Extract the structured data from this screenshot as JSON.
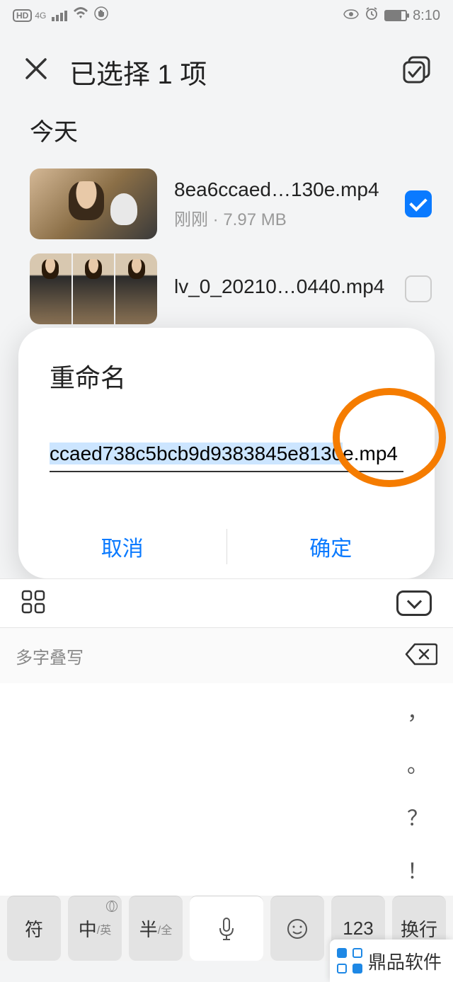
{
  "status_bar": {
    "hd": "HD",
    "net_gen": "4G",
    "time": "8:10"
  },
  "header": {
    "title": "已选择 1 项"
  },
  "section": {
    "today": "今天"
  },
  "files": [
    {
      "name": "8ea6ccaed…130e.mp4",
      "meta": "刚刚 · 7.97 MB",
      "checked": true
    },
    {
      "name": "lv_0_20210…0440.mp4",
      "meta": "",
      "checked": false
    }
  ],
  "dialog": {
    "title": "重命名",
    "filename_sel": "ccaed738c5bcb9d9383845e8130",
    "filename_ext": "e.mp4",
    "cancel": "取消",
    "confirm": "确定"
  },
  "keyboard": {
    "suggest": "多字叠写",
    "symbols": [
      "，",
      "。",
      "？",
      "！"
    ],
    "keys": {
      "sym": "符",
      "cn": "中",
      "cn_sub": "/英",
      "half": "半",
      "half_sub": "/全",
      "num": "123",
      "enter": "换行"
    }
  },
  "watermark": "鼎品软件"
}
